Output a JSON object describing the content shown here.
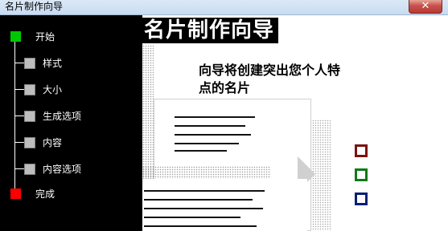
{
  "window": {
    "title": "名片制作向导",
    "close_glyph": "✕"
  },
  "nav": {
    "items": [
      {
        "label": "开始",
        "kind": "start",
        "color": "#00c800"
      },
      {
        "label": "样式",
        "kind": "sub"
      },
      {
        "label": "大小",
        "kind": "sub"
      },
      {
        "label": "生成选项",
        "kind": "sub"
      },
      {
        "label": "内容",
        "kind": "sub"
      },
      {
        "label": "内容选项",
        "kind": "sub"
      },
      {
        "label": "完成",
        "kind": "finish",
        "color": "#ff0000"
      }
    ]
  },
  "main": {
    "heading": "名片制作向导",
    "subtitle_line1": "向导将创建突出您个人特",
    "subtitle_line2": "点的名片",
    "checkbox_colors": [
      "#7a1212",
      "#0e7a17",
      "#0c1f74"
    ]
  }
}
